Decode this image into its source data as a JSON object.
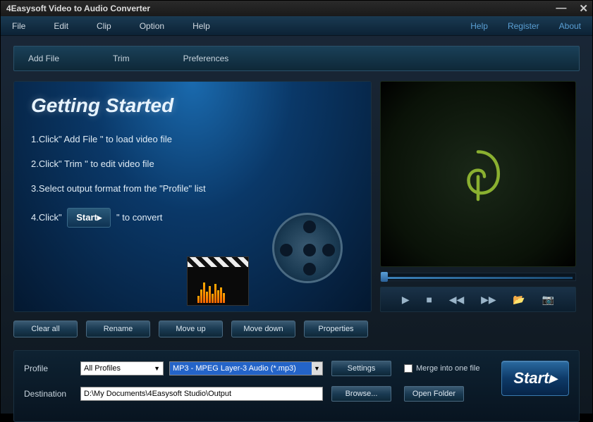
{
  "title": "4Easysoft Video to Audio Converter",
  "menu": {
    "file": "File",
    "edit": "Edit",
    "clip": "Clip",
    "option": "Option",
    "help": "Help"
  },
  "links": {
    "help": "Help",
    "register": "Register",
    "about": "About"
  },
  "toolbar": {
    "addfile": "Add File",
    "trim": "Trim",
    "prefs": "Preferences"
  },
  "welcome": {
    "title": "Getting Started",
    "step1": "1.Click\" Add File \" to load video file",
    "step2": "2.Click\" Trim \" to edit video file",
    "step3": "3.Select output format from the \"Profile\" list",
    "step4a": "4.Click\"",
    "step4btn": "Start▸",
    "step4b": "\" to convert"
  },
  "actions": {
    "clearall": "Clear all",
    "rename": "Rename",
    "moveup": "Move up",
    "movedown": "Move down",
    "props": "Properties"
  },
  "profile": {
    "label": "Profile",
    "filter": "All Profiles",
    "format": "MP3 - MPEG Layer-3 Audio (*.mp3)",
    "settings": "Settings",
    "merge": "Merge into one file"
  },
  "dest": {
    "label": "Destination",
    "path": "D:\\My Documents\\4Easysoft Studio\\Output",
    "browse": "Browse...",
    "open": "Open Folder"
  },
  "start": "Start▸"
}
